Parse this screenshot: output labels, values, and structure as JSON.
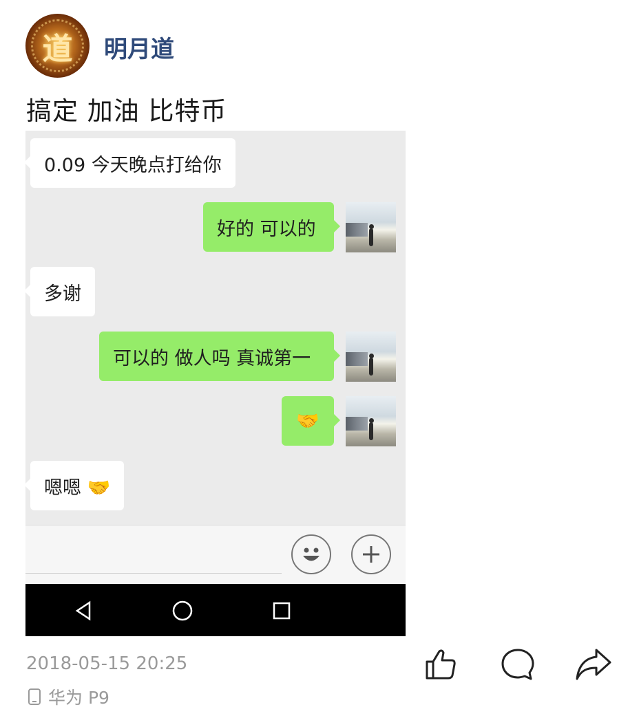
{
  "post": {
    "username": "明月道",
    "avatar_glyph": "道",
    "text": "搞定 加油 比特币",
    "timestamp": "2018-05-15 20:25",
    "device": "华为 P9"
  },
  "chat": {
    "messages": [
      {
        "side": "in",
        "text": "0.09 今天晚点打给你"
      },
      {
        "side": "out",
        "text": "好的 可以的"
      },
      {
        "side": "in",
        "text": "多谢"
      },
      {
        "side": "out",
        "text": "可以的 做人吗 真诚第一"
      },
      {
        "side": "out",
        "text": "🤝"
      },
      {
        "side": "in",
        "text": "嗯嗯 🤝"
      }
    ]
  },
  "colors": {
    "outgoing_bubble": "#95ec69",
    "incoming_bubble": "#ffffff",
    "username": "#2f4a7a",
    "meta_text": "#9a9a9a"
  },
  "icons": {
    "input_bar": [
      "emoji-icon",
      "plus-icon"
    ],
    "nav_bar": [
      "back-triangle-icon",
      "home-circle-icon",
      "recents-square-icon"
    ],
    "post_actions": [
      "like-icon",
      "comment-icon",
      "share-icon"
    ],
    "device": "phone-icon"
  }
}
